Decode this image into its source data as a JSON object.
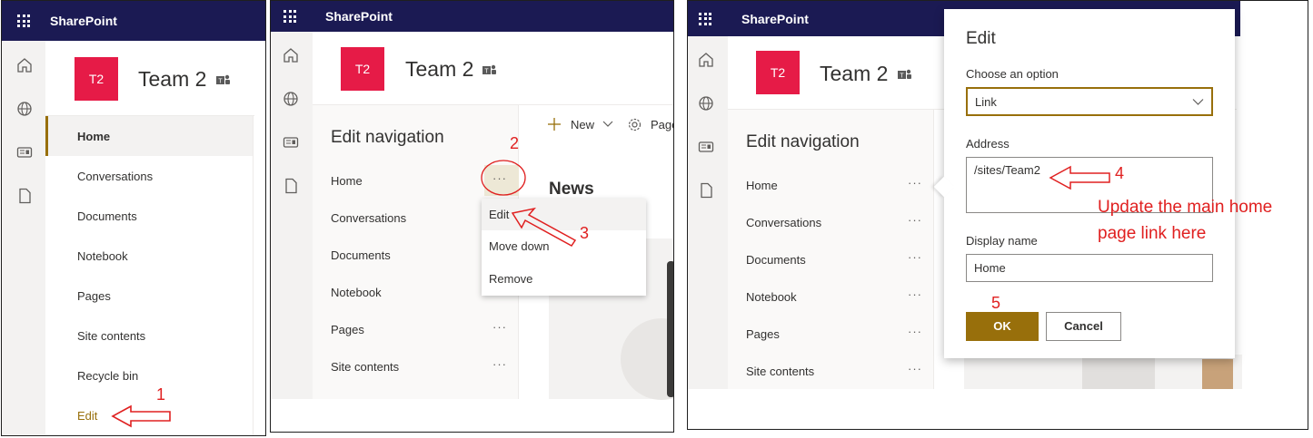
{
  "app": "SharePoint",
  "site": {
    "logo_text": "T2",
    "name": "Team 2"
  },
  "panel1": {
    "nav": [
      "Home",
      "Conversations",
      "Documents",
      "Notebook",
      "Pages",
      "Site contents",
      "Recycle bin"
    ],
    "edit_link": "Edit",
    "step": "1"
  },
  "panel2": {
    "heading": "Edit navigation",
    "nav": [
      "Home",
      "Conversations",
      "Documents",
      "Notebook",
      "Pages",
      "Site contents"
    ],
    "more": "···",
    "menu": [
      "Edit",
      "Move down",
      "Remove"
    ],
    "toolbar_new": "New",
    "toolbar_page": "Page",
    "news": "News",
    "step_more": "2",
    "step_edit": "3"
  },
  "panel3": {
    "heading": "Edit navigation",
    "nav": [
      "Home",
      "Conversations",
      "Documents",
      "Notebook",
      "Pages",
      "Site contents"
    ],
    "more": "···",
    "dialog": {
      "title": "Edit",
      "choose_label": "Choose an option",
      "choose_value": "Link",
      "address_label": "Address",
      "address_value": "/sites/Team2",
      "display_label": "Display name",
      "display_value": "Home",
      "ok": "OK",
      "cancel": "Cancel"
    },
    "step_address": "4",
    "step_ok": "5",
    "annotation_line1": "Update the main home",
    "annotation_line2": "page link here"
  },
  "colors": {
    "suitebar": "#1b1a53",
    "logo": "#e61b47",
    "accent": "#986f0b",
    "annotation": "#e02020"
  }
}
